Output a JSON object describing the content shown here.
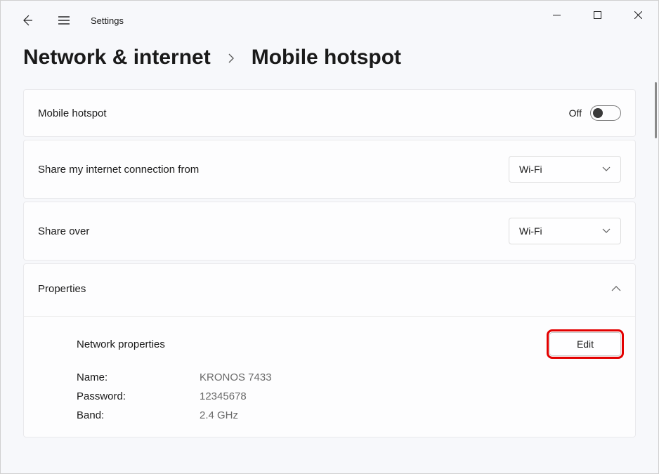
{
  "app": {
    "title": "Settings"
  },
  "breadcrumb": {
    "parent": "Network & internet",
    "current": "Mobile hotspot"
  },
  "hotspot": {
    "label": "Mobile hotspot",
    "state_label": "Off"
  },
  "share_from": {
    "label": "Share my internet connection from",
    "value": "Wi-Fi"
  },
  "share_over": {
    "label": "Share over",
    "value": "Wi-Fi"
  },
  "properties": {
    "heading": "Properties",
    "network_props_label": "Network properties",
    "edit_label": "Edit",
    "rows": {
      "name_key": "Name:",
      "name_val": "KRONOS 7433",
      "password_key": "Password:",
      "password_val": "12345678",
      "band_key": "Band:",
      "band_val": "2.4 GHz"
    }
  }
}
